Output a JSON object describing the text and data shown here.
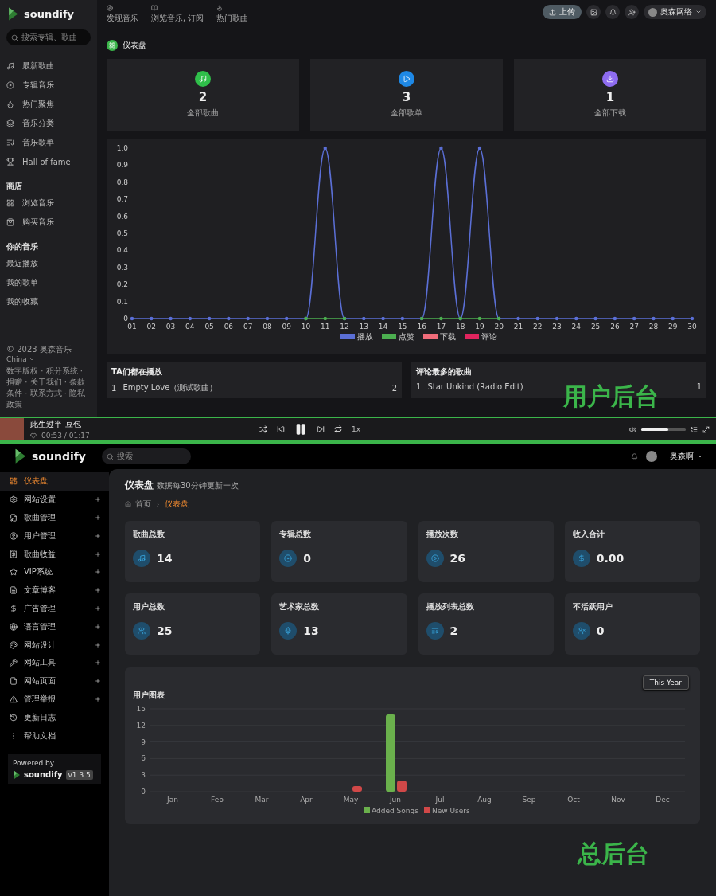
{
  "user_panel": {
    "logo": "soundify",
    "search": {
      "placeholder": "搜索专辑、歌曲"
    },
    "sidebar": {
      "items": [
        {
          "label": "最新歌曲"
        },
        {
          "label": "专辑音乐"
        },
        {
          "label": "热门聚焦"
        },
        {
          "label": "音乐分类"
        },
        {
          "label": "音乐歌单"
        },
        {
          "label": "Hall of fame"
        }
      ],
      "sections": [
        {
          "title": "商店",
          "items": [
            "浏览音乐",
            "购买音乐"
          ]
        },
        {
          "title": "你的音乐",
          "items": [
            "最近播放",
            "我的歌单",
            "我的收藏"
          ]
        }
      ],
      "footer": {
        "copyright": "© 2023 奥森音乐",
        "region": "China",
        "links": "数字版权 · 积分系统 · 捐赠 · 关于我们 · 条款条件 · 联系方式 · 隐私政策"
      }
    },
    "nav": [
      "发现音乐",
      "浏览音乐, 订阅",
      "热门歌曲"
    ],
    "topbar": {
      "upload": "上传",
      "user": "奥森网络"
    },
    "title": "仪表盘",
    "stats": [
      {
        "value": "2",
        "label": "全部歌曲",
        "color": "#2fbf4a"
      },
      {
        "value": "3",
        "label": "全部歌单",
        "color": "#1e88e5"
      },
      {
        "value": "1",
        "label": "全部下载",
        "color": "#8e6cf0"
      }
    ],
    "chart": {
      "chart_data": {
        "type": "line",
        "categories": [
          "01",
          "02",
          "03",
          "04",
          "05",
          "06",
          "07",
          "08",
          "09",
          "10",
          "11",
          "12",
          "13",
          "14",
          "15",
          "16",
          "17",
          "18",
          "19",
          "20",
          "21",
          "22",
          "23",
          "24",
          "25",
          "26",
          "27",
          "28",
          "29",
          "30"
        ],
        "ylim": [
          0,
          1
        ],
        "yticks": [
          0,
          0.1,
          0.2,
          0.3,
          0.4,
          0.5,
          0.6,
          0.7,
          0.8,
          0.9,
          {
            "value": 1,
            "label": "1.0"
          }
        ],
        "legend": "bottom",
        "series": [
          {
            "name": "播放",
            "color": "#5b6fd6",
            "values": [
              0,
              0,
              0,
              0,
              0,
              0,
              0,
              0,
              0,
              0,
              1,
              0,
              0,
              0,
              0,
              0,
              1,
              0,
              1,
              0,
              0,
              0,
              0,
              0,
              0,
              0,
              0,
              0,
              0,
              0
            ]
          },
          {
            "name": "点赞",
            "color": "#4caf50",
            "values": [
              null,
              null,
              null,
              null,
              null,
              null,
              null,
              null,
              null,
              0,
              0,
              0,
              null,
              null,
              null,
              0,
              0,
              0,
              0,
              0,
              null,
              null,
              null,
              null,
              null,
              null,
              null,
              null,
              null,
              null
            ]
          },
          {
            "name": "下载",
            "color": "#f06c7a",
            "values": [
              null,
              null,
              null,
              null,
              null,
              null,
              null,
              null,
              null,
              null,
              null,
              null,
              null,
              null,
              null,
              null,
              null,
              null,
              null,
              null,
              null,
              null,
              null,
              null,
              null,
              null,
              null,
              null,
              null,
              null
            ]
          },
          {
            "name": "评论",
            "color": "#e0245e",
            "values": [
              null,
              null,
              null,
              null,
              null,
              null,
              null,
              null,
              null,
              null,
              null,
              null,
              null,
              null,
              null,
              null,
              null,
              null,
              null,
              null,
              null,
              null,
              null,
              null,
              null,
              null,
              null,
              null,
              null,
              null
            ]
          }
        ]
      }
    },
    "lists": [
      {
        "title": "TA们都在播放",
        "rows": [
          {
            "rank": "1",
            "name": "Empty Love（测试歌曲）",
            "count": "2"
          }
        ]
      },
      {
        "title": "评论最多的歌曲",
        "rows": [
          {
            "rank": "1",
            "name": "Star Unkind (Radio Edit)",
            "count": "1"
          }
        ]
      }
    ],
    "player": {
      "title": "此生过半-豆包",
      "time": "00:53 / 01:17",
      "speed": "1x",
      "volume": {
        "level": 0.6
      }
    },
    "caption": "用户后台"
  },
  "admin_panel": {
    "logo": "soundify",
    "search": {
      "placeholder": "搜索"
    },
    "user": "奥森啊",
    "sidebar": [
      {
        "label": "仪表盘",
        "selected": true,
        "expandable": false
      },
      {
        "label": "网站设置",
        "selected": false,
        "expandable": true
      },
      {
        "label": "歌曲管理",
        "selected": false,
        "expandable": true
      },
      {
        "label": "用户管理",
        "selected": false,
        "expandable": true
      },
      {
        "label": "歌曲收益",
        "selected": false,
        "expandable": true
      },
      {
        "label": "VIP系统",
        "selected": false,
        "expandable": true
      },
      {
        "label": "文章博客",
        "selected": false,
        "expandable": true
      },
      {
        "label": "广告管理",
        "selected": false,
        "expandable": true
      },
      {
        "label": "语言管理",
        "selected": false,
        "expandable": true
      },
      {
        "label": "网站设计",
        "selected": false,
        "expandable": true
      },
      {
        "label": "网站工具",
        "selected": false,
        "expandable": true
      },
      {
        "label": "网站页面",
        "selected": false,
        "expandable": true
      },
      {
        "label": "管理举报",
        "selected": false,
        "expandable": true
      },
      {
        "label": "更新日志",
        "selected": false,
        "expandable": false
      },
      {
        "label": "帮助文档",
        "selected": false,
        "expandable": false
      }
    ],
    "powered": {
      "label": "Powered by",
      "logo": "soundify",
      "version": "v1.3.5"
    },
    "title": "仪表盘",
    "subtitle": "数据每30分钟更新一次",
    "breadcrumb": [
      "首页",
      "仪表盘"
    ],
    "stats": [
      {
        "label": "歌曲总数",
        "value": "14"
      },
      {
        "label": "专辑总数",
        "value": "0"
      },
      {
        "label": "播放次数",
        "value": "26"
      },
      {
        "label": "收入合计",
        "value": "0.00"
      },
      {
        "label": "用户总数",
        "value": "25"
      },
      {
        "label": "艺术家总数",
        "value": "13"
      },
      {
        "label": "播放列表总数",
        "value": "2"
      },
      {
        "label": "不活跃用户",
        "value": "0"
      }
    ],
    "chart": {
      "title": "用户图表",
      "range": "This Year",
      "chart_data": {
        "type": "bar",
        "categories": [
          "Jan",
          "Feb",
          "Mar",
          "Apr",
          "May",
          "Jun",
          "Jul",
          "Aug",
          "Sep",
          "Oct",
          "Nov",
          "Dec"
        ],
        "ylim": [
          0,
          15
        ],
        "yticks": [
          0,
          3,
          6,
          9,
          12,
          15
        ],
        "legend": "bottom",
        "grid": true,
        "series": [
          {
            "name": "Added Songs",
            "color": "#6ab04c",
            "values": [
              0,
              0,
              0,
              0,
              0,
              14,
              0,
              0,
              0,
              0,
              0,
              0
            ]
          },
          {
            "name": "New Users",
            "color": "#d04848",
            "values": [
              0,
              0,
              0,
              0,
              1,
              2,
              0,
              0,
              0,
              0,
              0,
              0
            ]
          }
        ]
      }
    },
    "caption": "总后台"
  }
}
